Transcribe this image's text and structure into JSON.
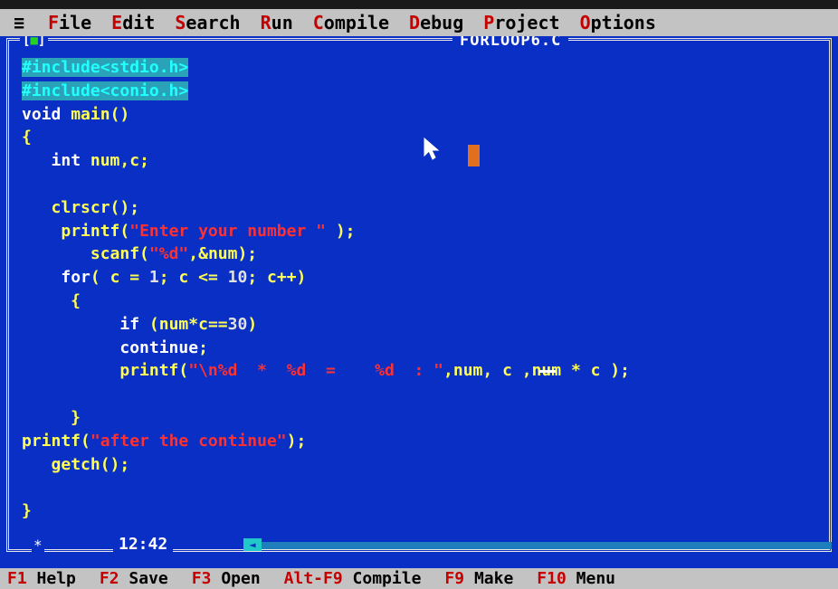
{
  "menu": {
    "system_glyph": "≡",
    "items": [
      {
        "hot": "F",
        "rest": "ile"
      },
      {
        "hot": "E",
        "rest": "dit"
      },
      {
        "hot": "S",
        "rest": "earch"
      },
      {
        "hot": "R",
        "rest": "un"
      },
      {
        "hot": "C",
        "rest": "ompile"
      },
      {
        "hot": "D",
        "rest": "ebug"
      },
      {
        "hot": "P",
        "rest": "roject"
      },
      {
        "hot": "O",
        "rest": "ptions"
      }
    ]
  },
  "window": {
    "close_box": "[■]",
    "title": "FORLOOP6.C",
    "clock": "12:42",
    "star": "*"
  },
  "code": {
    "lines": [
      "#include<stdio.h>",
      "#include<conio.h>",
      "void main()",
      "{",
      "   int num,c;",
      "",
      "   clrscr();",
      "    printf(\"Enter your number \" );",
      "       scanf(\"%d\",&num);",
      "    for( c = 1; c <= 10; c++)",
      "     {",
      "          if (num*c==30)",
      "          continue;",
      "          printf(\"\\n%d  *  %d  =    %d  : \",num, c ,num * c );",
      "",
      "     }",
      "printf(\"after the continue\");",
      "   getch();",
      "",
      "}"
    ]
  },
  "fkeys": [
    {
      "key": "F1",
      "label": "Help"
    },
    {
      "key": "F2",
      "label": "Save"
    },
    {
      "key": "F3",
      "label": "Open"
    },
    {
      "key": "Alt-F9",
      "label": "Compile"
    },
    {
      "key": "F9",
      "label": "Make"
    },
    {
      "key": "F10",
      "label": "Menu"
    }
  ],
  "colors": {
    "editor_bg": "#0a2fc4",
    "menu_bg": "#c3c3c3",
    "hotkey": "#c40000",
    "string": "#ff3030",
    "identifier": "#ffff55",
    "preprocessor": "#22ffff"
  }
}
